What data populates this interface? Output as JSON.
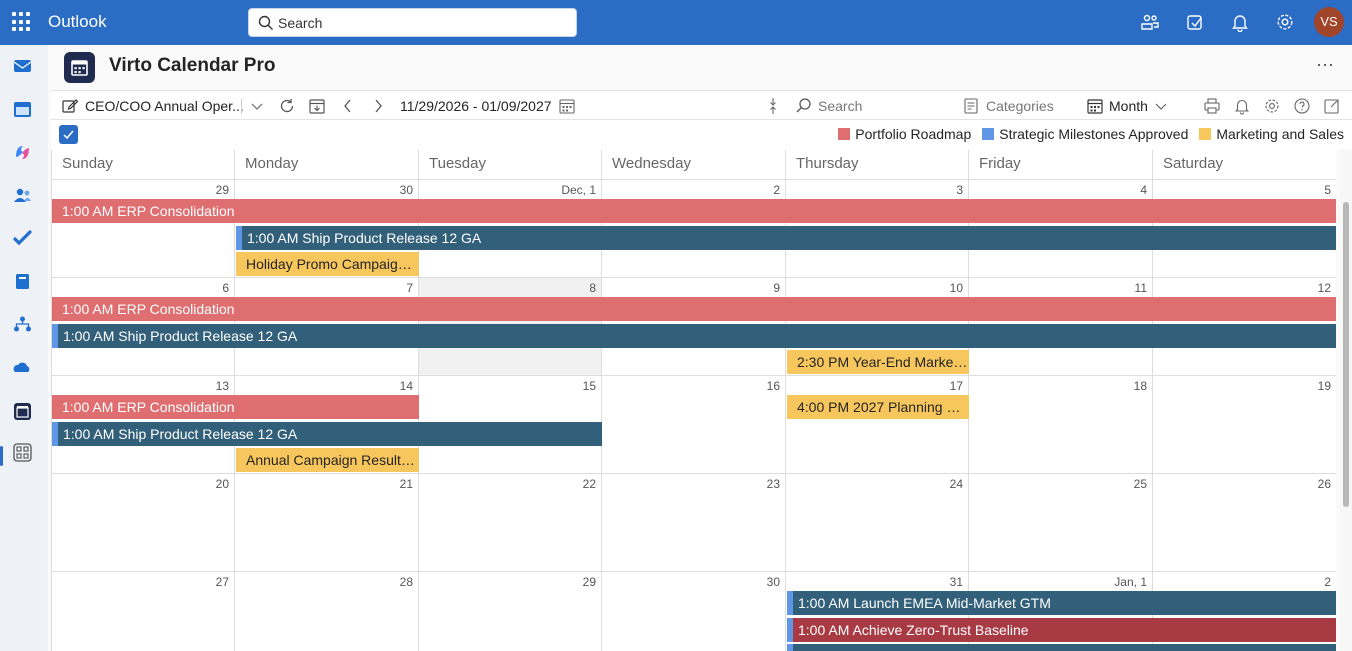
{
  "topbar": {
    "brand": "Outlook",
    "search_placeholder": "Search",
    "avatar_initials": "VS",
    "icons": [
      "teams-icon",
      "notes-icon",
      "bell-icon",
      "settings-icon"
    ]
  },
  "rail": {
    "icons": [
      "mail-icon",
      "calendar-icon",
      "copilot-icon",
      "people-icon",
      "todo-icon",
      "notes-book-icon",
      "org-icon",
      "onedrive-icon",
      "virto-calendar-icon",
      "apps-icon"
    ]
  },
  "app": {
    "title": "Virto Calendar Pro",
    "more": "⋯"
  },
  "toolbar": {
    "calendar_name": "CEO/COO Annual Oper...",
    "date_range": "11/29/2026 - 01/09/2027",
    "search_placeholder": "Search",
    "categories_label": "Categories",
    "view_label": "Month"
  },
  "colors": {
    "portfolio": "#df6e71",
    "milestones": "#5f96e6",
    "marketing": "#f7c65d",
    "teal": "#32607a",
    "darkred": "#a83a44",
    "accent": "#2b6cc4"
  },
  "legend": [
    {
      "label": "Portfolio Roadmap",
      "color": "#df6e71"
    },
    {
      "label": "Strategic Milestones Approved",
      "color": "#5f96e6"
    },
    {
      "label": "Marketing and Sales",
      "color": "#f7c65d"
    }
  ],
  "calendar": {
    "weekdays": [
      "Sunday",
      "Monday",
      "Tuesday",
      "Wednesday",
      "Thursday",
      "Friday",
      "Saturday"
    ],
    "weeks": [
      {
        "days": [
          "29",
          "30",
          "Dec, 1",
          "2",
          "3",
          "4",
          "5"
        ]
      },
      {
        "days": [
          "6",
          "7",
          "8",
          "9",
          "10",
          "11",
          "12"
        ]
      },
      {
        "days": [
          "13",
          "14",
          "15",
          "16",
          "17",
          "18",
          "19"
        ]
      },
      {
        "days": [
          "20",
          "21",
          "22",
          "23",
          "24",
          "25",
          "26"
        ]
      },
      {
        "days": [
          "27",
          "28",
          "29",
          "30",
          "31",
          "Jan, 1",
          "2"
        ]
      }
    ],
    "today": {
      "week": 1,
      "day": 2
    },
    "events": [
      {
        "week": 0,
        "start": 0,
        "span": 7,
        "lane": 0,
        "style": "red",
        "text": "1:00 AM ERP Consolidation"
      },
      {
        "week": 0,
        "start": 1,
        "span": 6,
        "lane": 1,
        "style": "teal",
        "text": "1:00 AM Ship Product Release 12 GA"
      },
      {
        "week": 0,
        "start": 1,
        "span": 1,
        "lane": 2,
        "style": "yellow",
        "text": "Holiday Promo Campaign ..."
      },
      {
        "week": 1,
        "start": 0,
        "span": 7,
        "lane": 0,
        "style": "red",
        "text": "1:00 AM ERP Consolidation"
      },
      {
        "week": 1,
        "start": 0,
        "span": 7,
        "lane": 1,
        "style": "teal",
        "text": "1:00 AM Ship Product Release 12 GA"
      },
      {
        "week": 1,
        "start": 4,
        "span": 1,
        "lane": 2,
        "style": "yellow",
        "text": "2:30 PM Year-End Marketin..."
      },
      {
        "week": 2,
        "start": 0,
        "span": 2,
        "lane": 0,
        "style": "red",
        "text": "1:00 AM ERP Consolidation"
      },
      {
        "week": 2,
        "start": 4,
        "span": 1,
        "lane": 0,
        "style": "yellow",
        "text": "4:00 PM 2027 Planning Kic..."
      },
      {
        "week": 2,
        "start": 0,
        "span": 3,
        "lane": 1,
        "style": "teal",
        "text": "1:00 AM Ship Product Release 12 GA"
      },
      {
        "week": 2,
        "start": 1,
        "span": 1,
        "lane": 2,
        "style": "yellow",
        "text": "Annual Campaign Results P..."
      },
      {
        "week": 4,
        "start": 4,
        "span": 3,
        "lane": 0,
        "style": "teal",
        "text": "1:00 AM Launch EMEA Mid-Market GTM"
      },
      {
        "week": 4,
        "start": 4,
        "span": 3,
        "lane": 1,
        "style": "darkred",
        "text": "1:00 AM Achieve Zero-Trust Baseline"
      },
      {
        "week": 4,
        "start": 4,
        "span": 3,
        "lane": 2,
        "style": "teal",
        "text": ""
      }
    ]
  }
}
